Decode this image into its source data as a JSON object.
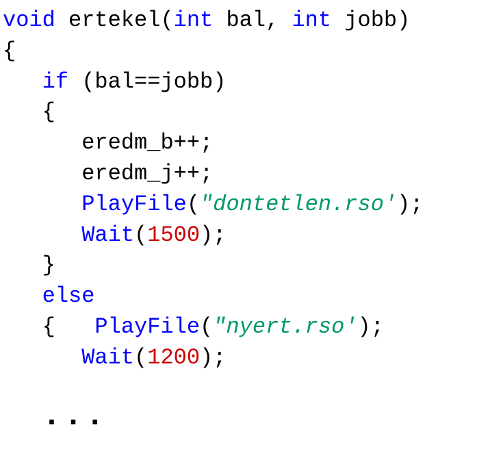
{
  "code": {
    "kw_void": "void",
    "fn_name": "ertekel",
    "kw_int1": "int",
    "param1": "bal",
    "kw_int2": "int",
    "param2": "jobb",
    "brace_open_fn": "{",
    "kw_if": "if",
    "cond_expr": "(bal==jobb)",
    "brace_open_if": "{",
    "stmt_eredm_b": "eredm_b++;",
    "stmt_eredm_j": "eredm_j++;",
    "fn_playfile1": "PlayFile",
    "str_dontetlen": "\"dontetlen.rso'",
    "fn_wait1": "Wait",
    "num_1500": "1500",
    "brace_close_if": "}",
    "kw_else": "else",
    "brace_open_else": "{",
    "fn_playfile2": "PlayFile",
    "str_nyert": "\"nyert.rso'",
    "fn_wait2": "Wait",
    "num_1200": "1200",
    "ellipsis": "..."
  }
}
